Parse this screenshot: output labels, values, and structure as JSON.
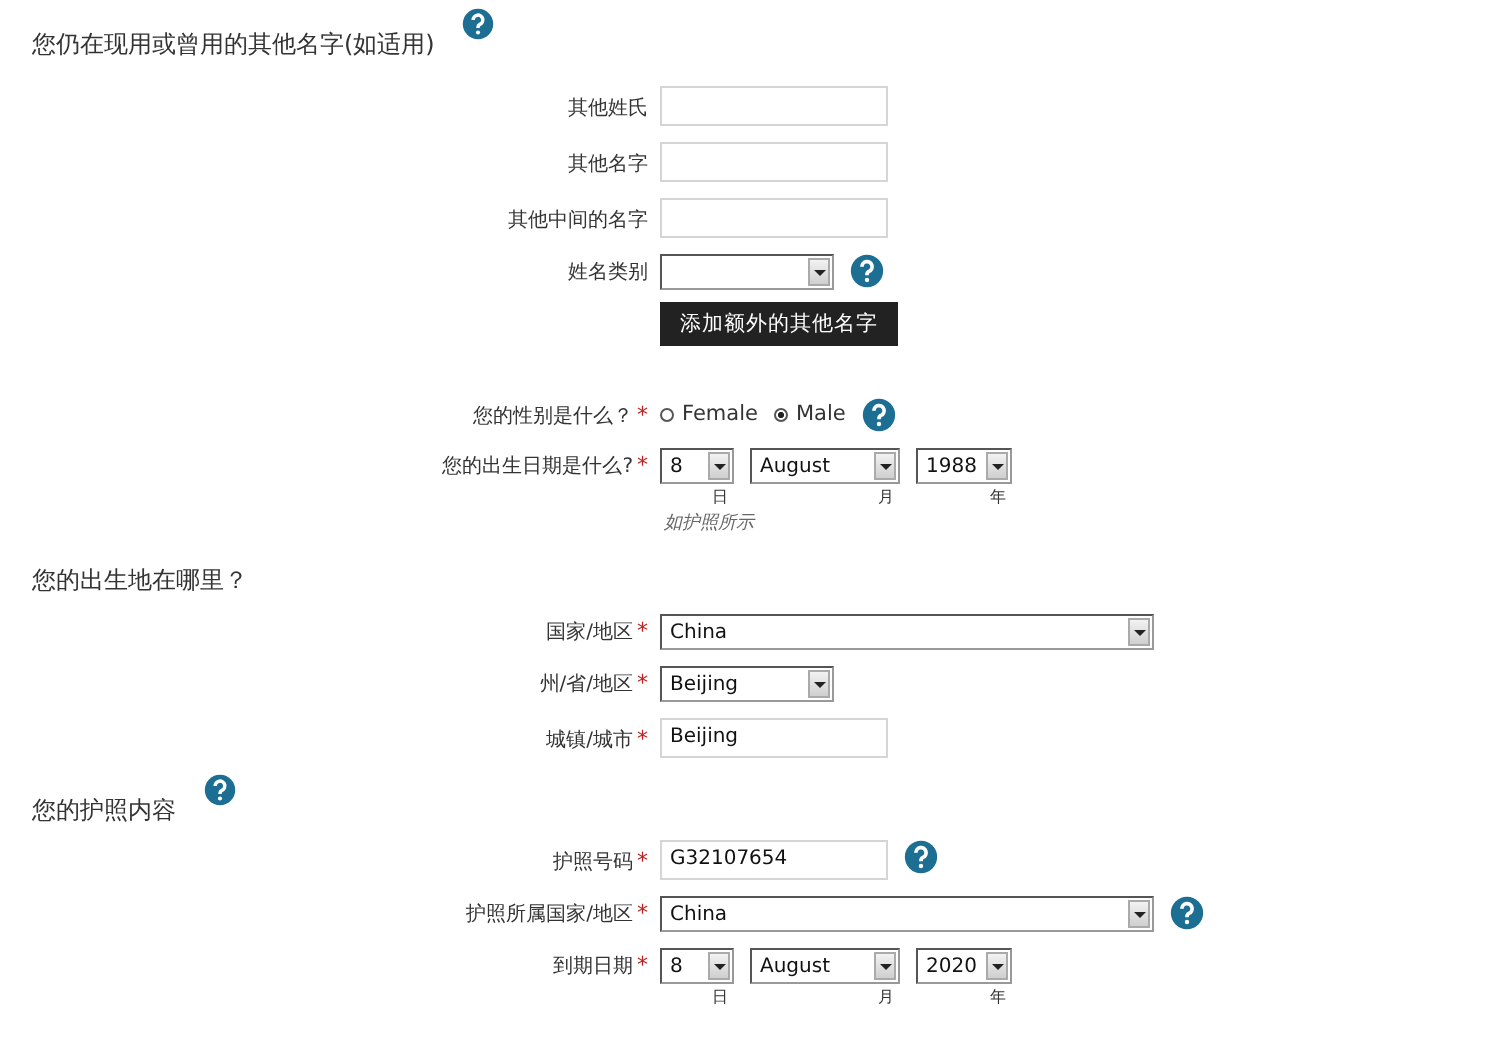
{
  "sections": [
    {
      "title": "您仍在现用或曾用的其他名字(如适用)",
      "help": true,
      "fields": [
        {
          "kind": "text",
          "label": "其他姓氏"
        },
        {
          "kind": "text",
          "label": "其他名字"
        },
        {
          "kind": "text",
          "label": "其他中间的名字"
        },
        {
          "kind": "select",
          "label": "姓名类别",
          "help": true
        },
        {
          "kind": "button",
          "label": "添加额外的其他名字"
        },
        {
          "kind": "gap"
        },
        {
          "kind": "radio",
          "label": "您的性别是什么？",
          "mark": "*",
          "help": true,
          "options": [
            {
              "label": "Female",
              "selected": false
            },
            {
              "label": "Male",
              "selected": true
            }
          ]
        },
        {
          "kind": "date",
          "label": "您的出生日期是什么?",
          "mark": "*",
          "parts": [
            {
              "value": "8",
              "unit": "日"
            },
            {
              "value": "August",
              "unit": "月"
            },
            {
              "value": "1988",
              "unit": "年"
            }
          ],
          "note": "如护照所示"
        }
      ]
    },
    {
      "title": "您的出生地在哪里？",
      "fields": [
        {
          "kind": "select-wide",
          "label": "国家/地区",
          "mark": "*",
          "value": "China"
        },
        {
          "kind": "select",
          "label": "州/省/地区",
          "mark": "*",
          "value": "Beijing"
        },
        {
          "kind": "text",
          "label": "城镇/城市",
          "mark": "*",
          "value": "Beijing"
        }
      ]
    },
    {
      "title": "您的护照内容",
      "help": true,
      "fields": [
        {
          "kind": "text",
          "label": "护照号码",
          "mark": "*",
          "value": "G32107654",
          "help": true
        },
        {
          "kind": "select-wide",
          "label": "护照所属国家/地区",
          "mark": "*",
          "value": "China",
          "help": true
        },
        {
          "kind": "date",
          "label": "到期日期",
          "mark": "*",
          "parts": [
            {
              "value": "8",
              "unit": "日"
            },
            {
              "value": "August",
              "unit": "月"
            },
            {
              "value": "2020",
              "unit": "年"
            }
          ]
        }
      ]
    }
  ]
}
